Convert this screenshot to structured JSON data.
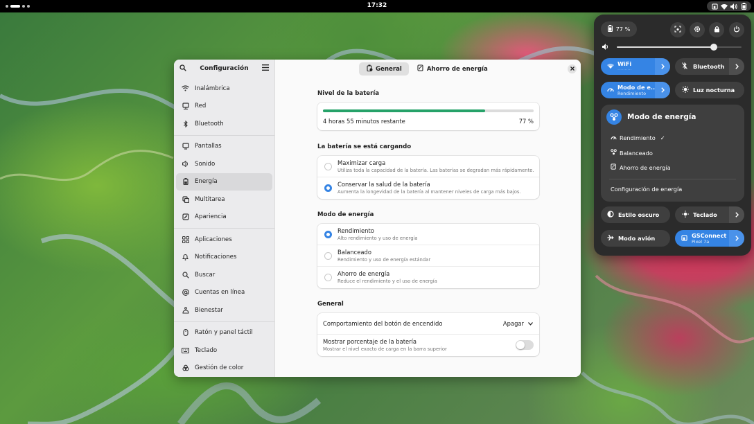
{
  "topbar": {
    "clock": "17:32"
  },
  "settings": {
    "sidebar_title": "Configuración",
    "sidebar_groups": [
      [
        {
          "label": "Inalámbrica",
          "icon": "wifi-icon"
        },
        {
          "label": "Red",
          "icon": "network-icon"
        },
        {
          "label": "Bluetooth",
          "icon": "bluetooth-icon"
        }
      ],
      [
        {
          "label": "Pantallas",
          "icon": "display-icon"
        },
        {
          "label": "Sonido",
          "icon": "sound-icon"
        },
        {
          "label": "Energía",
          "icon": "power-icon",
          "active": true
        },
        {
          "label": "Multitarea",
          "icon": "multitasking-icon"
        },
        {
          "label": "Apariencia",
          "icon": "appearance-icon"
        }
      ],
      [
        {
          "label": "Aplicaciones",
          "icon": "apps-icon"
        },
        {
          "label": "Notificaciones",
          "icon": "bell-icon"
        },
        {
          "label": "Buscar",
          "icon": "search-icon"
        },
        {
          "label": "Cuentas en línea",
          "icon": "at-icon"
        },
        {
          "label": "Bienestar",
          "icon": "wellbeing-icon"
        }
      ],
      [
        {
          "label": "Ratón y panel táctil",
          "icon": "mouse-icon"
        },
        {
          "label": "Teclado",
          "icon": "keyboard-icon"
        },
        {
          "label": "Gestión de color",
          "icon": "color-icon"
        }
      ]
    ],
    "tabs": {
      "general": "General",
      "saver": "Ahorro de energía"
    },
    "battery": {
      "title": "Nivel de la batería",
      "remaining": "4 horas 55 minutos restante",
      "percent": "77 %",
      "level": 0.77
    },
    "charging": {
      "title": "La batería se está cargando",
      "options": [
        {
          "title": "Maximizar carga",
          "subtitle": "Utiliza toda la capacidad de la batería. Las baterías se degradan más rápidamente.",
          "checked": false
        },
        {
          "title": "Conservar la salud de la batería",
          "subtitle": "Aumenta la longevidad de la batería al mantener niveles de carga más bajos.",
          "checked": true
        }
      ]
    },
    "power_mode": {
      "title": "Modo de energía",
      "options": [
        {
          "title": "Rendimiento",
          "subtitle": "Alto rendimiento y uso de energía",
          "checked": true
        },
        {
          "title": "Balanceado",
          "subtitle": "Rendimiento y uso de energía estándar",
          "checked": false
        },
        {
          "title": "Ahorro de energía",
          "subtitle": "Reduce el rendimiento y el uso de energía",
          "checked": false
        }
      ]
    },
    "general": {
      "title": "General",
      "power_button_label": "Comportamiento del botón de encendido",
      "power_button_value": "Apagar",
      "show_percent_label": "Mostrar porcentaje de la batería",
      "show_percent_sub": "Mostrar el nivel exacto de carga en la barra superior",
      "show_percent_on": false
    }
  },
  "quick_settings": {
    "battery": "77 %",
    "volume_level": 0.78,
    "wifi_label": "WiFi",
    "wifi_sub": "··········",
    "bluetooth_label": "Bluetooth",
    "power_mode_label": "Modo de e...",
    "power_mode_sub": "Rendimiento",
    "night_light_label": "Luz nocturna",
    "menu": {
      "title": "Modo de energía",
      "items": [
        "Rendimiento",
        "Balanceado",
        "Ahorro de energía"
      ],
      "selected_mark": "✓",
      "settings_link": "Configuración de energía"
    },
    "dark_style_label": "Estilo oscuro",
    "keyboard_label": "Teclado",
    "airplane_label": "Modo avión",
    "gsconnect_label": "GSConnect",
    "gsconnect_sub": "Pixel 7a"
  },
  "colors": {
    "accent": "#3584e4",
    "progress": "#26a269",
    "panel": "#2b2b2b"
  }
}
